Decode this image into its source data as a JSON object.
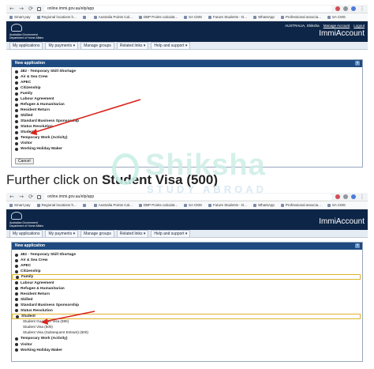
{
  "screenshot1": {
    "browser": {
      "url": "online.immi.gov.au/elp/app",
      "bookmarks": [
        "Smart pay",
        "Regional locations h...",
        "",
        "Australia Points Cal...",
        "DBP Points calculat...",
        "SA CMS",
        "Future Students - D...",
        "WhatsApp",
        "Professional associa...",
        "SA CMS"
      ]
    },
    "header": {
      "gov_line1": "Australian Government",
      "gov_line2": "Department of Home Affairs",
      "top_links": [
        "AUSTRALIA, Shiksha",
        "Manage Account",
        "Logout"
      ],
      "brand": "ImmiAccount"
    },
    "menubar": [
      "My applications",
      "My payments ▾",
      "Manage groups",
      "Related links ▾",
      "Help and support ▾"
    ],
    "panel_title": "New application",
    "help_label": "?",
    "items": [
      "482 - Temporary Skill Shortage",
      "Air & Sea Crew",
      "APEC",
      "Citizenship",
      "Family",
      "Labour Agreement",
      "Refugee & Humanitarian",
      "Resident Return",
      "Skilled",
      "Standard Business Sponsorship",
      "Status Resolution",
      "Student",
      "Temporary Work (Activity)",
      "Visitor",
      "Working Holiday Maker"
    ],
    "cancel_label": "Cancel"
  },
  "caption": {
    "prefix": "Further click on ",
    "emphasis": "Student Visa (500)"
  },
  "watermark": {
    "name": "Shiksha",
    "tagline": "STUDY ABROAD"
  },
  "screenshot2": {
    "browser": {
      "url": "online.immi.gov.au/elp/app",
      "bookmarks": [
        "Smart pay",
        "Regional locations h...",
        "",
        "Australia Points Cal...",
        "DBP Points calculat...",
        "SA CMS",
        "Future Students - D...",
        "WhatsApp",
        "Professional associa...",
        "SA CMS"
      ]
    },
    "header": {
      "gov_line1": "Australian Government",
      "gov_line2": "Department of Home Affairs",
      "brand": "ImmiAccount"
    },
    "menubar": [
      "My applications",
      "My payments ▾",
      "Manage groups",
      "Related links ▾",
      "Help and support ▾"
    ],
    "panel_title": "New application",
    "help_label": "?",
    "items_before": [
      "482 - Temporary Skill Shortage",
      "Air & Sea Crew",
      "APEC",
      "Citizenship",
      "Family",
      "Labour Agreement",
      "Refugee & Humanitarian",
      "Resident Return",
      "Skilled",
      "Standard Business Sponsorship",
      "Status Resolution",
      "Student"
    ],
    "student_sub": [
      "Student Guardian Visa (590)",
      "Student Visa (500)",
      "Student Visa (Subsequent Entrant) (500)"
    ],
    "items_after": [
      "Temporary Work (Activity)",
      "Visitor",
      "Working Holiday Maker"
    ],
    "cancel_label": "Cancel"
  },
  "colors": {
    "header_navy": "#0d2547",
    "panel_blue": "#1e4a80",
    "highlight_outline": "#e0b32e",
    "arrow_red": "#d9241c"
  }
}
